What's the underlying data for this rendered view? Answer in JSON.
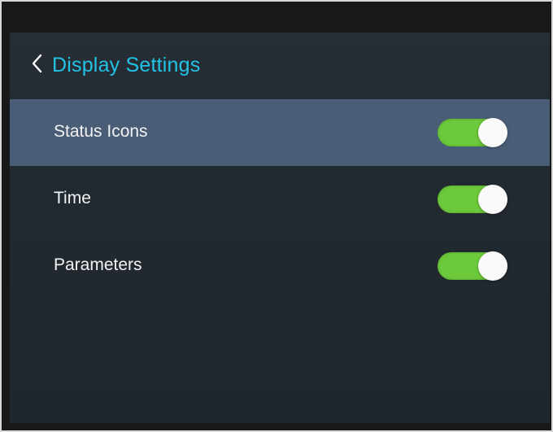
{
  "header": {
    "back_icon": "chevron-left-icon",
    "title": "Display Settings"
  },
  "colors": {
    "title": "#22c3e6",
    "selected_row": "#4a5d77",
    "toggle_on": "#6cc93b",
    "background": "#232a31"
  },
  "settings": [
    {
      "label": "Status Icons",
      "enabled": true,
      "selected": true
    },
    {
      "label": "Time",
      "enabled": true,
      "selected": false
    },
    {
      "label": "Parameters",
      "enabled": true,
      "selected": false
    }
  ]
}
